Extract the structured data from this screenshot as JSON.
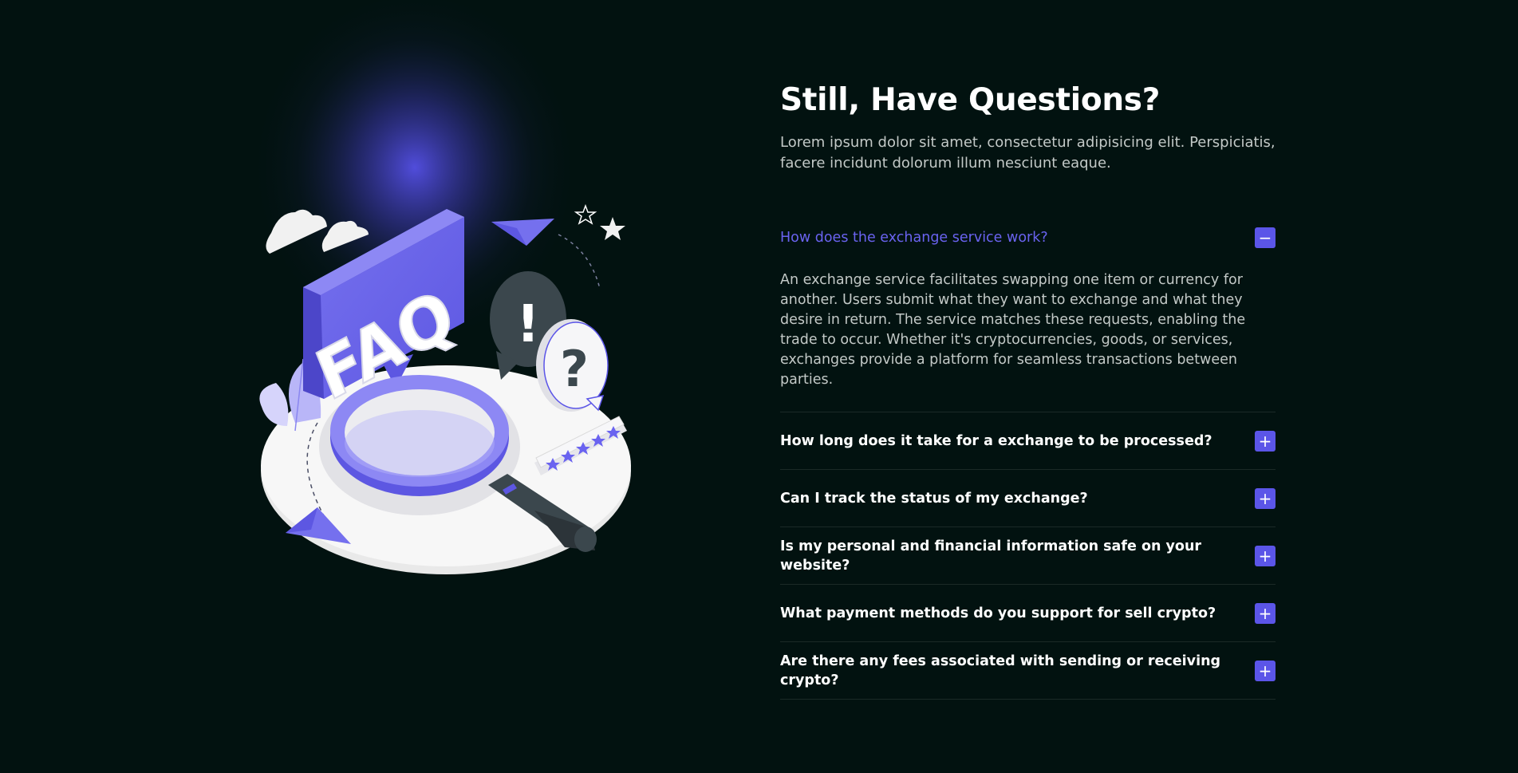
{
  "faq": {
    "title": "Still, Have Questions?",
    "subtitle": "Lorem ipsum dolor sit amet, consectetur adipisicing elit. Perspiciatis, facere incidunt dolorum illum nesciunt eaque.",
    "items": [
      {
        "question": "How does the exchange service work?",
        "answer": "An exchange service facilitates swapping one item or currency for another. Users submit what they want to exchange and what they desire in return. The service matches these requests, enabling the trade to occur. Whether it's cryptocurrencies, goods, or services, exchanges provide a platform for seamless transactions between parties.",
        "expanded": true,
        "toggle_symbol": "−"
      },
      {
        "question": "How long does it take for a exchange to be processed?",
        "expanded": false,
        "toggle_symbol": "+"
      },
      {
        "question": "Can I track the status of my exchange?",
        "expanded": false,
        "toggle_symbol": "+"
      },
      {
        "question": "Is my personal and financial information safe on your website?",
        "expanded": false,
        "toggle_symbol": "+"
      },
      {
        "question": "What payment methods do you support for sell crypto?",
        "expanded": false,
        "toggle_symbol": "+"
      },
      {
        "question": "Are there any fees associated with sending or receiving crypto?",
        "expanded": false,
        "toggle_symbol": "+"
      }
    ]
  },
  "illustration": {
    "sign_text": "FAQ",
    "exclamation": "!",
    "question_mark": "?",
    "rating_stars": 5
  },
  "colors": {
    "background": "#021210",
    "accent": "#5b55e8",
    "accent_text": "#6a63f0",
    "body_text": "#c3c9c7"
  }
}
